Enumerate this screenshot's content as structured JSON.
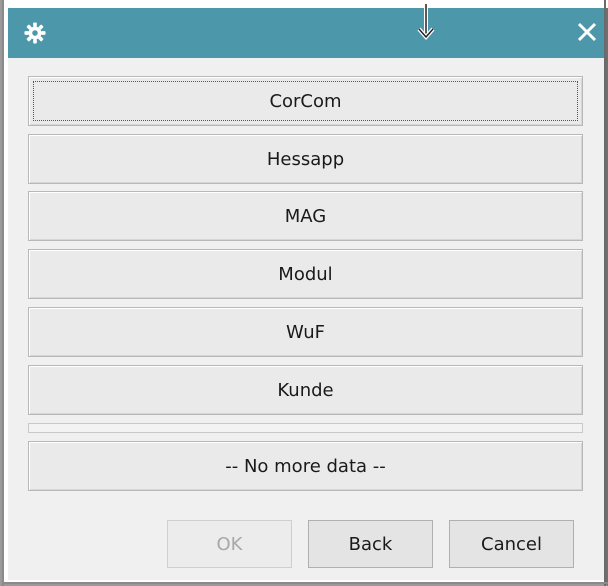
{
  "titlebar": {
    "icon": "gear-icon",
    "pointer_icon": "down-arrow-icon",
    "close_icon": "close-icon",
    "color": "#4d97ab"
  },
  "list": {
    "items": [
      {
        "label": "CorCom",
        "focused": true
      },
      {
        "label": "Hessapp"
      },
      {
        "label": "MAG"
      },
      {
        "label": "Modul"
      },
      {
        "label": "WuF"
      },
      {
        "label": "Kunde"
      }
    ],
    "no_more_label": "-- No more data --"
  },
  "footer": {
    "ok_label": "OK",
    "back_label": "Back",
    "cancel_label": "Cancel"
  }
}
